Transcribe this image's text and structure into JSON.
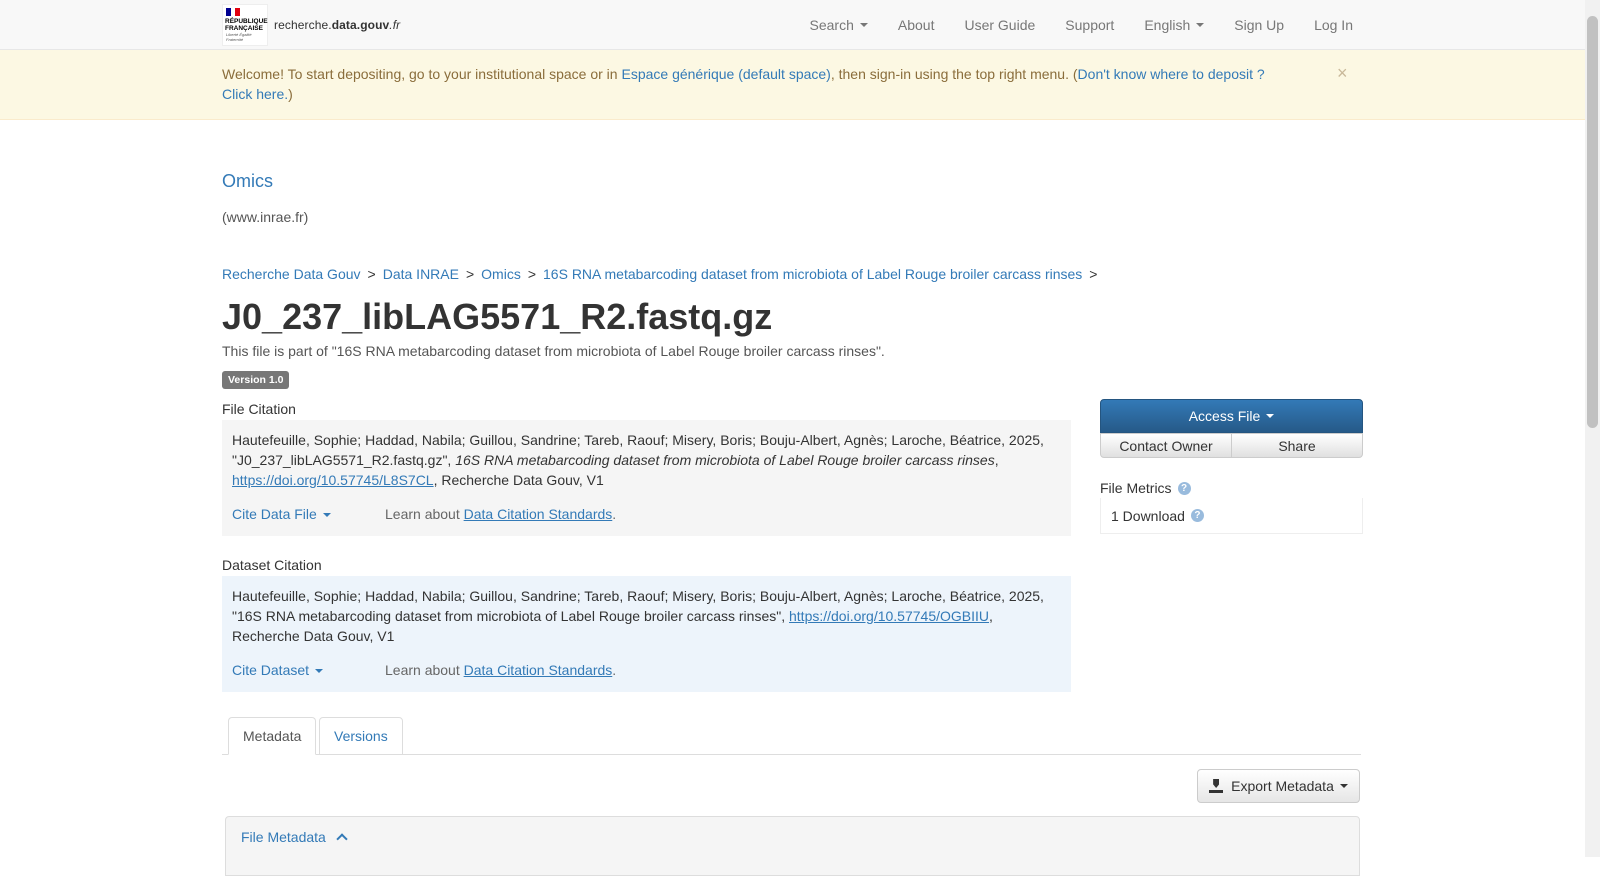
{
  "navbar": {
    "logo_title": "RÉPUBLIQUE FRANÇAISE",
    "logo_motto": "Liberté Égalité Fraternité",
    "site_name_prefix": "recherche.",
    "site_name_bold": "data.gouv",
    "site_name_suffix": ".fr",
    "items": {
      "search": "Search",
      "about": "About",
      "user_guide": "User Guide",
      "support": "Support",
      "language": "English",
      "sign_up": "Sign Up",
      "log_in": "Log In"
    }
  },
  "alert": {
    "text_1": "Welcome! To start depositing, go to your institutional space or in ",
    "link_1": "Espace générique (default space)",
    "text_2": ", then sign-in using the top right menu. (",
    "link_2": "Don't know where to deposit ? Click here.",
    "text_3": ")",
    "close": "×"
  },
  "dataverse": {
    "name": "Omics",
    "affiliation": "(www.inrae.fr)"
  },
  "breadcrumb": {
    "items": [
      "Recherche Data Gouv",
      "Data INRAE",
      "Omics",
      "16S RNA metabarcoding dataset from microbiota of Label Rouge broiler carcass rinses"
    ],
    "separator": ">"
  },
  "file": {
    "title": "J0_237_libLAG5571_R2.fastq.gz",
    "subtitle": "This file is part of \"16S RNA metabarcoding dataset from microbiota of Label Rouge broiler carcass rinses\".",
    "version": "Version 1.0"
  },
  "file_citation": {
    "label": "File Citation",
    "authors": "Hautefeuille, Sophie; Haddad, Nabila; Guillou, Sandrine; Tareb, Raouf; Misery, Boris; Bouju-Albert, Agnès; Laroche, Béatrice, 2025, \"J0_237_libLAG5571_R2.fastq.gz\", ",
    "dataset_title": "16S RNA metabarcoding dataset from microbiota of Label Rouge broiler carcass rinses",
    "sep": ", ",
    "doi": "https://doi.org/10.57745/L8S7CL",
    "suffix": ", Recherche Data Gouv, V1",
    "cite_button": "Cite Data File",
    "learn_prefix": "Learn about ",
    "learn_link": "Data Citation Standards",
    "learn_suffix": "."
  },
  "dataset_citation": {
    "label": "Dataset Citation",
    "text": "Hautefeuille, Sophie; Haddad, Nabila; Guillou, Sandrine; Tareb, Raouf; Misery, Boris; Bouju-Albert, Agnès; Laroche, Béatrice, 2025, \"16S RNA metabarcoding dataset from microbiota of Label Rouge broiler carcass rinses\", ",
    "doi": "https://doi.org/10.57745/OGBIIU",
    "suffix": ", Recherche Data Gouv, V1",
    "cite_button": "Cite Dataset",
    "learn_prefix": "Learn about ",
    "learn_link": "Data Citation Standards",
    "learn_suffix": "."
  },
  "actions": {
    "access_file": "Access File",
    "contact_owner": "Contact Owner",
    "share": "Share"
  },
  "metrics": {
    "title": "File Metrics",
    "downloads": "1 Download",
    "help_glyph": "?"
  },
  "tabs": {
    "metadata": "Metadata",
    "versions": "Versions"
  },
  "export": {
    "label": "Export Metadata"
  },
  "panel": {
    "title": "File Metadata"
  },
  "colors": {
    "link": "#337ab7",
    "alert_bg": "#fcf8e3",
    "alert_text": "#8a6d3b",
    "primary_button": "#337ab7",
    "dataset_citation_bg": "#edf4fb",
    "file_citation_bg": "#f5f5f5"
  }
}
